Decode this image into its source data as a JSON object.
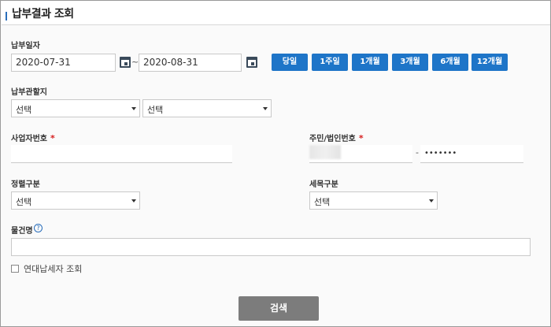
{
  "header": {
    "title": "납부결과 조회"
  },
  "payment_date": {
    "label": "납부일자",
    "start": "2020-07-31",
    "separator": "~",
    "end": "2020-08-31",
    "periods": [
      "당일",
      "1주일",
      "1개월",
      "3개월",
      "6개월",
      "12개월"
    ]
  },
  "jurisdiction": {
    "label": "납부관할지",
    "select1": "선택",
    "select2": "선택"
  },
  "business_no": {
    "label": "사업자번호",
    "required_mark": "*",
    "value": ""
  },
  "resident_no": {
    "label": "주민/법인번호",
    "required_mark": "*",
    "separator": "-",
    "back": "•••••••"
  },
  "correction_type": {
    "label": "정렬구분",
    "value": "선택"
  },
  "tax_type": {
    "label": "세목구분",
    "value": "선택"
  },
  "item_name": {
    "label": "물건명",
    "help": "?",
    "value": ""
  },
  "joint_taxpayer": {
    "label": "연대납세자 조회",
    "checked": false
  },
  "search_button": {
    "label": "검색"
  },
  "colors": {
    "accent": "#1e75c8",
    "required": "#d61d1d",
    "search_button": "#7c7c7c"
  }
}
